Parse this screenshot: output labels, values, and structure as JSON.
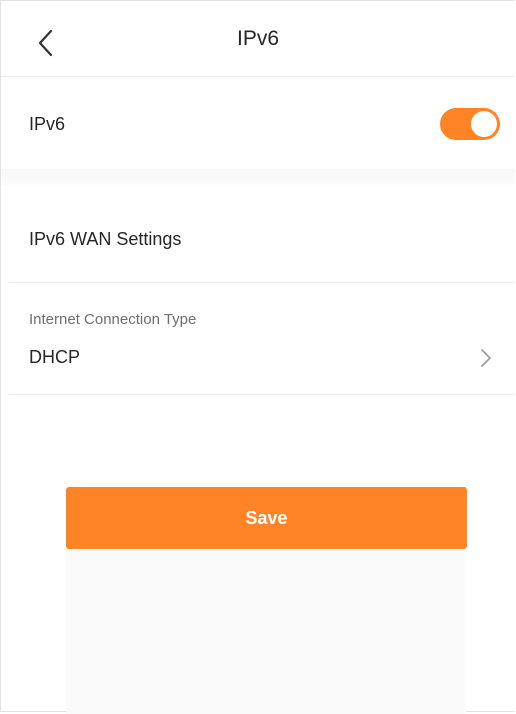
{
  "header": {
    "title": "IPv6",
    "back_icon": "chevron-left-icon"
  },
  "ipv6_toggle": {
    "label": "IPv6",
    "enabled": true,
    "color": "#ff8425"
  },
  "wan_settings": {
    "section_title": "IPv6 WAN Settings",
    "connection_type": {
      "caption": "Internet Connection Type",
      "value": "DHCP",
      "icon": "chevron-right-icon"
    }
  },
  "actions": {
    "save_label": "Save",
    "save_color": "#ff8425"
  }
}
